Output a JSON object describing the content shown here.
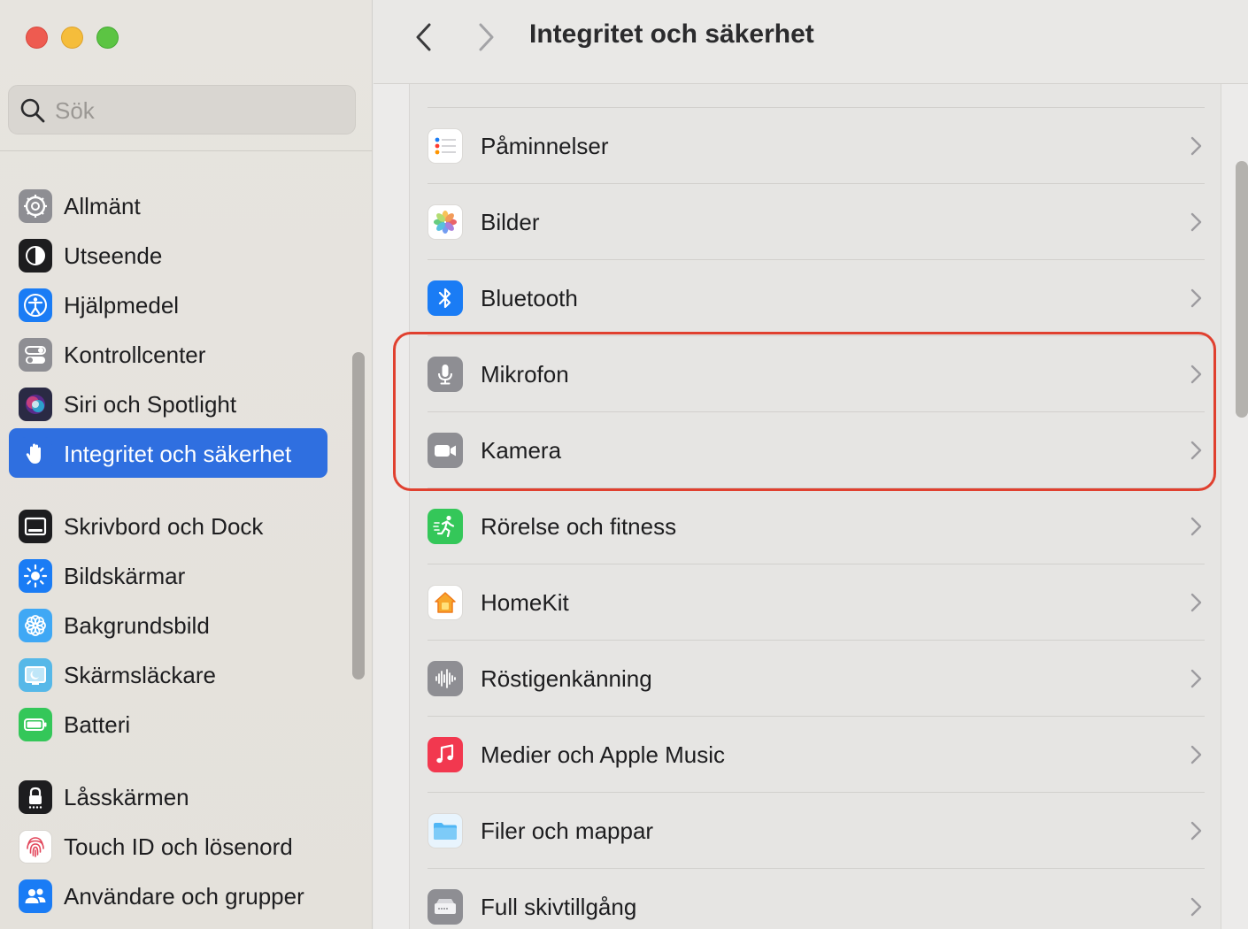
{
  "window": {
    "title": "Integritet och säkerhet",
    "back_label": "‹",
    "forward_label": "›"
  },
  "search": {
    "placeholder": "Sök",
    "value": ""
  },
  "sidebar": {
    "items": [
      {
        "label": "Allmänt",
        "icon": "gear-icon",
        "color": "#8e8e93"
      },
      {
        "label": "Utseende",
        "icon": "appearance-icon",
        "color": "#1d1d1f"
      },
      {
        "label": "Hjälpmedel",
        "icon": "accessibility-icon",
        "color": "#1a7cf5"
      },
      {
        "label": "Kontrollcenter",
        "icon": "toggles-icon",
        "color": "#8e8e93"
      },
      {
        "label": "Siri och Spotlight",
        "icon": "siri-icon",
        "color": "#2a2a44"
      },
      {
        "label": "Integritet och säkerhet",
        "icon": "hand-icon",
        "color": "#2f6fe0",
        "selected": true
      },
      {
        "label": "Skrivbord och Dock",
        "icon": "dock-icon",
        "color": "#1d1d1f"
      },
      {
        "label": "Bildskärmar",
        "icon": "sun-icon",
        "color": "#1a7cf5"
      },
      {
        "label": "Bakgrundsbild",
        "icon": "flower-icon",
        "color": "#3fa8f5"
      },
      {
        "label": "Skärmsläckare",
        "icon": "screensaver-icon",
        "color": "#56b8e8"
      },
      {
        "label": "Batteri",
        "icon": "battery-icon",
        "color": "#34c759"
      },
      {
        "label": "Låsskärmen",
        "icon": "lock-icon",
        "color": "#1d1d1f"
      },
      {
        "label": "Touch ID och lösenord",
        "icon": "fingerprint-icon",
        "color": "#ffffff"
      },
      {
        "label": "Användare och grupper",
        "icon": "users-icon",
        "color": "#1a7cf5"
      }
    ]
  },
  "privacy_list": {
    "rows": [
      {
        "label": "Påminnelser",
        "icon": "reminders-icon"
      },
      {
        "label": "Bilder",
        "icon": "photos-icon"
      },
      {
        "label": "Bluetooth",
        "icon": "bluetooth-icon"
      },
      {
        "label": "Mikrofon",
        "icon": "microphone-icon"
      },
      {
        "label": "Kamera",
        "icon": "camera-icon"
      },
      {
        "label": "Rörelse och fitness",
        "icon": "fitness-icon"
      },
      {
        "label": "HomeKit",
        "icon": "home-icon"
      },
      {
        "label": "Röstigenkänning",
        "icon": "waveform-icon"
      },
      {
        "label": "Medier och Apple Music",
        "icon": "music-icon"
      },
      {
        "label": "Filer och mappar",
        "icon": "folder-icon"
      },
      {
        "label": "Full skivtillgång",
        "icon": "disk-icon"
      }
    ]
  },
  "colors": {
    "accent": "#2f6fe0",
    "highlight": "#e0402f"
  }
}
